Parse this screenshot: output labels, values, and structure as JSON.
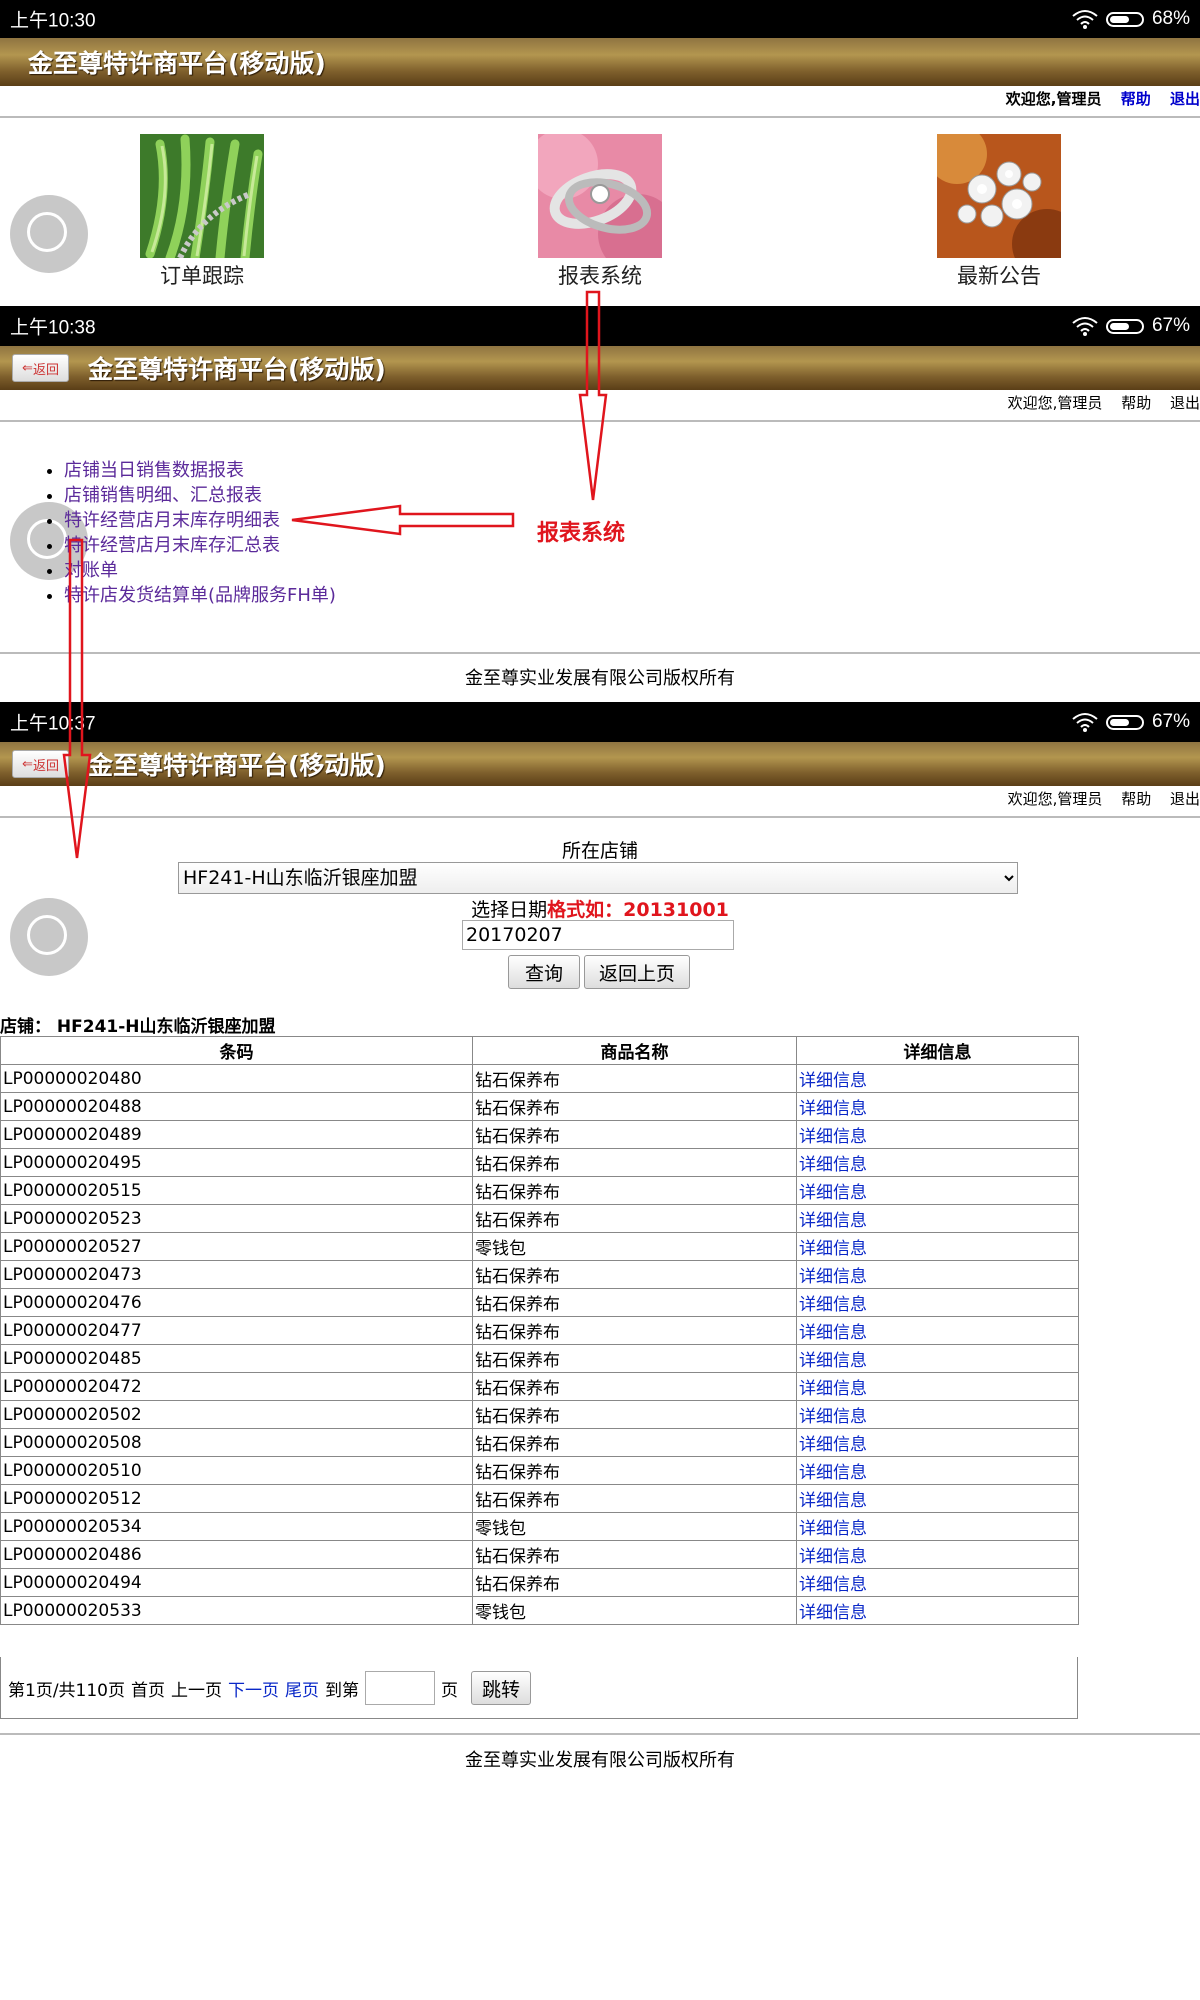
{
  "screen1": {
    "status": {
      "time": "上午10:30",
      "battery": "68%",
      "battery_level": 0.68
    },
    "title": "金至尊特许商平台(移动版)",
    "welcome": "欢迎您,管理员",
    "help": "帮助",
    "logout": "退出",
    "tiles": [
      {
        "label": "订单跟踪"
      },
      {
        "label": "报表系统"
      },
      {
        "label": "最新公告"
      }
    ]
  },
  "screen2": {
    "status": {
      "time": "上午10:38",
      "battery": "67%",
      "battery_level": 0.67
    },
    "back": "返回",
    "title": "金至尊特许商平台(移动版)",
    "welcome": "欢迎您,管理员",
    "help": "帮助",
    "logout": "退出",
    "menu": [
      "店铺当日销售数据报表",
      "店铺销售明细、汇总报表",
      "特许经营店月末库存明细表",
      "特许经营店月末库存汇总表",
      "对账单",
      "特许店发货结算单(品牌服务FH单)"
    ],
    "footer": "金至尊实业发展有限公司版权所有"
  },
  "annotation": "报表系统",
  "colors": {
    "annotation": "#e0151d",
    "link": "#0a28c8",
    "menu_link": "#5b2a9a"
  },
  "screen3": {
    "status": {
      "time": "上午10:37",
      "battery": "67%",
      "battery_level": 0.67
    },
    "back": "返回",
    "title": "金至尊特许商平台(移动版)",
    "welcome": "欢迎您,管理员",
    "help": "帮助",
    "logout": "退出",
    "store_label": "所在店铺",
    "store_selected": "HF241-H山东临沂银座加盟",
    "date_label": "选择日期",
    "date_hint": "格式如：20131001",
    "date_value": "20170207",
    "query_button": "查询",
    "back_button": "返回上页",
    "store_caption": "店铺： HF241-H山东临沂银座加盟",
    "table": {
      "headers": [
        "条码",
        "商品名称",
        "详细信息"
      ],
      "link_text": "详细信息",
      "rows": [
        [
          "LP00000020480",
          "钻石保养布"
        ],
        [
          "LP00000020488",
          "钻石保养布"
        ],
        [
          "LP00000020489",
          "钻石保养布"
        ],
        [
          "LP00000020495",
          "钻石保养布"
        ],
        [
          "LP00000020515",
          "钻石保养布"
        ],
        [
          "LP00000020523",
          "钻石保养布"
        ],
        [
          "LP00000020527",
          "零钱包"
        ],
        [
          "LP00000020473",
          "钻石保养布"
        ],
        [
          "LP00000020476",
          "钻石保养布"
        ],
        [
          "LP00000020477",
          "钻石保养布"
        ],
        [
          "LP00000020485",
          "钻石保养布"
        ],
        [
          "LP00000020472",
          "钻石保养布"
        ],
        [
          "LP00000020502",
          "钻石保养布"
        ],
        [
          "LP00000020508",
          "钻石保养布"
        ],
        [
          "LP00000020510",
          "钻石保养布"
        ],
        [
          "LP00000020512",
          "钻石保养布"
        ],
        [
          "LP00000020534",
          "零钱包"
        ],
        [
          "LP00000020486",
          "钻石保养布"
        ],
        [
          "LP00000020494",
          "钻石保养布"
        ],
        [
          "LP00000020533",
          "零钱包"
        ]
      ]
    },
    "pager": {
      "info": "第1页/共110页",
      "first": "首页",
      "prev": "上一页",
      "next": "下一页",
      "last": "尾页",
      "goto_prefix": "到第",
      "goto_suffix": "页",
      "jump": "跳转"
    },
    "footer": "金至尊实业发展有限公司版权所有"
  }
}
